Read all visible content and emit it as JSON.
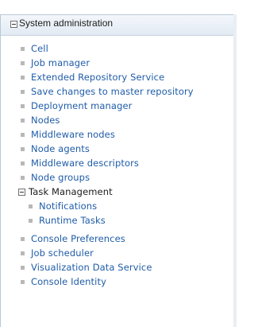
{
  "tree": {
    "section_label": "System administration",
    "items": [
      {
        "label": "Cell"
      },
      {
        "label": "Job manager"
      },
      {
        "label": "Extended Repository Service"
      },
      {
        "label": "Save changes to master repository"
      },
      {
        "label": "Deployment manager"
      },
      {
        "label": "Nodes"
      },
      {
        "label": "Middleware nodes"
      },
      {
        "label": "Node agents"
      },
      {
        "label": "Middleware descriptors"
      },
      {
        "label": "Node groups"
      }
    ],
    "task_group": {
      "label": "Task Management",
      "children": [
        {
          "label": "Notifications"
        },
        {
          "label": "Runtime Tasks"
        }
      ]
    },
    "items_after": [
      {
        "label": "Console Preferences"
      },
      {
        "label": "Job scheduler"
      },
      {
        "label": "Visualization Data Service"
      },
      {
        "label": "Console Identity"
      }
    ]
  }
}
